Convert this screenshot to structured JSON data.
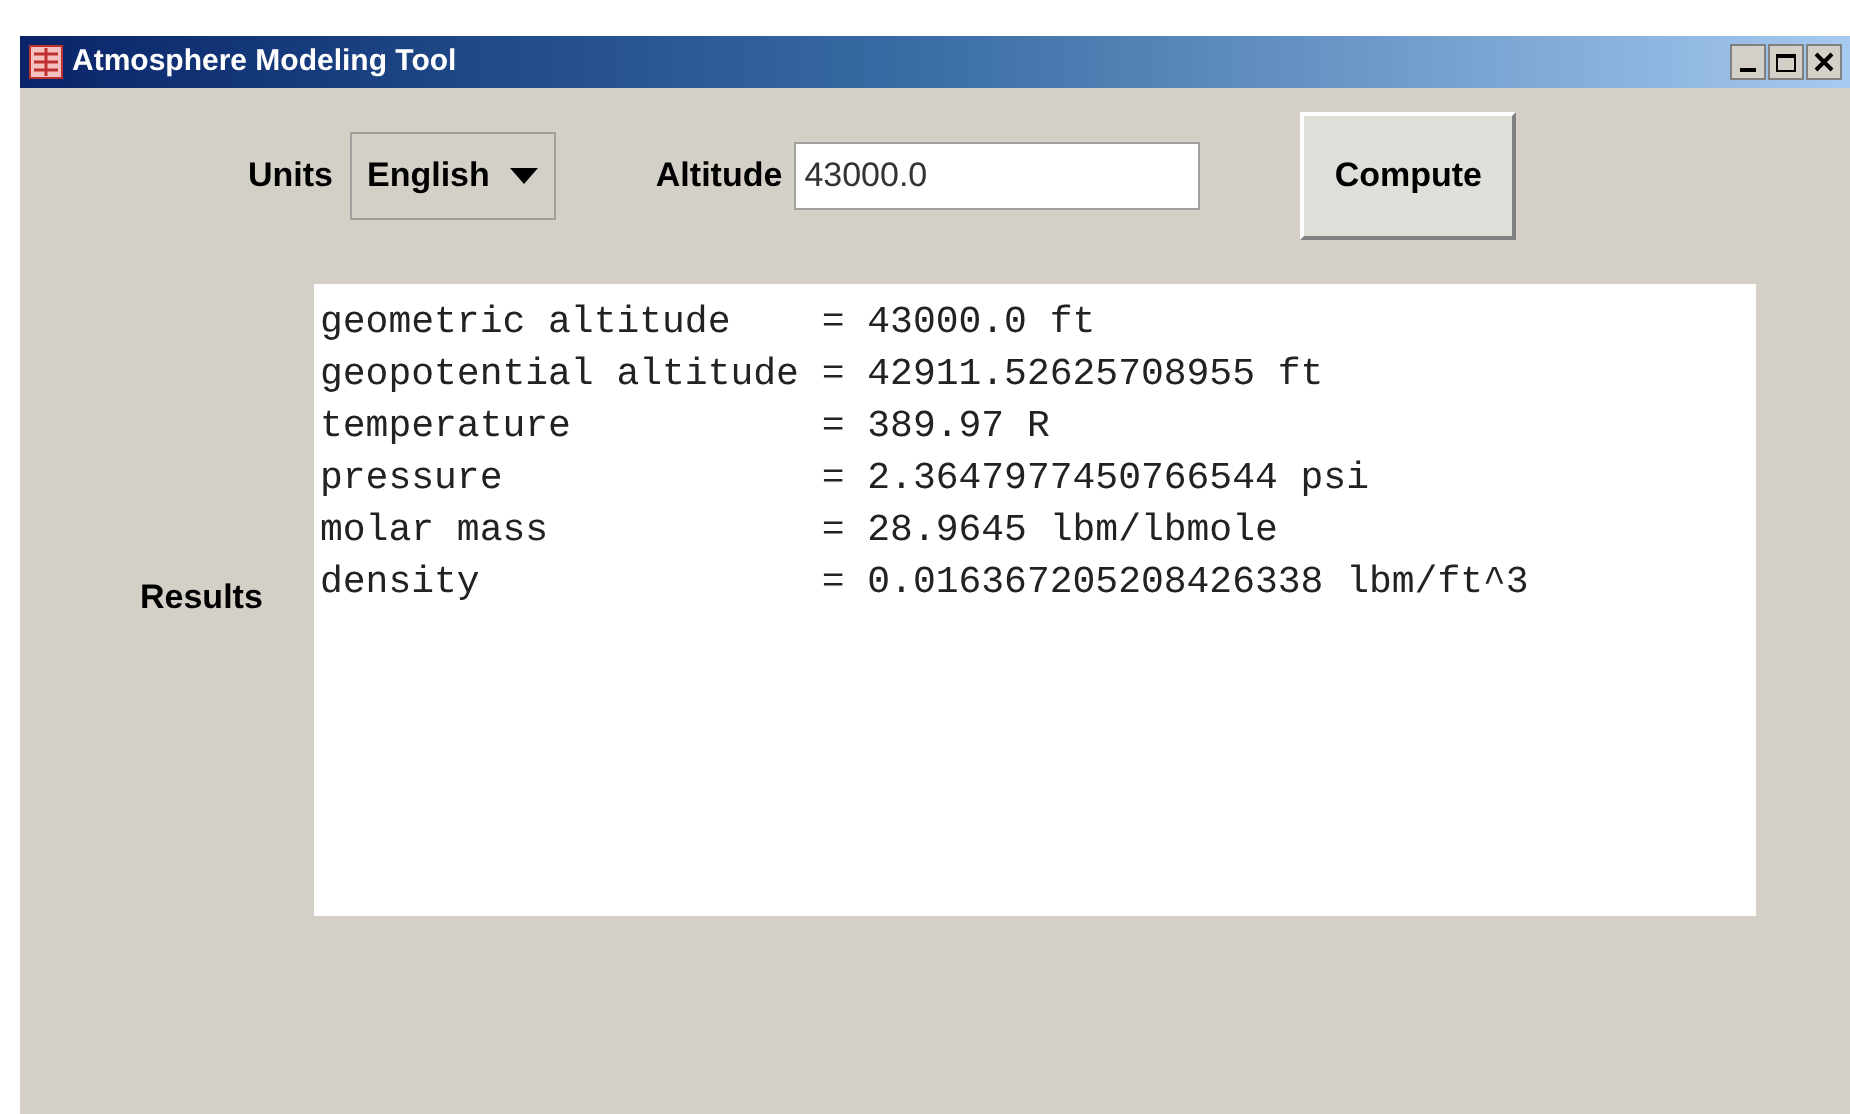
{
  "window": {
    "title": "Atmosphere Modeling Tool"
  },
  "units": {
    "label": "Units",
    "value": "English"
  },
  "altitude": {
    "label": "Altitude",
    "value": "43000.0"
  },
  "compute_button": "Compute",
  "results": {
    "label": "Results",
    "lines": [
      "geometric altitude    = 43000.0 ft",
      "geopotential altitude = 42911.52625708955 ft",
      "temperature           = 389.97 R",
      "pressure              = 2.3647977450766544 psi",
      "molar mass            = 28.9645 lbm/lbmole",
      "density               = 0.016367205208426338 lbm/ft^3"
    ]
  }
}
